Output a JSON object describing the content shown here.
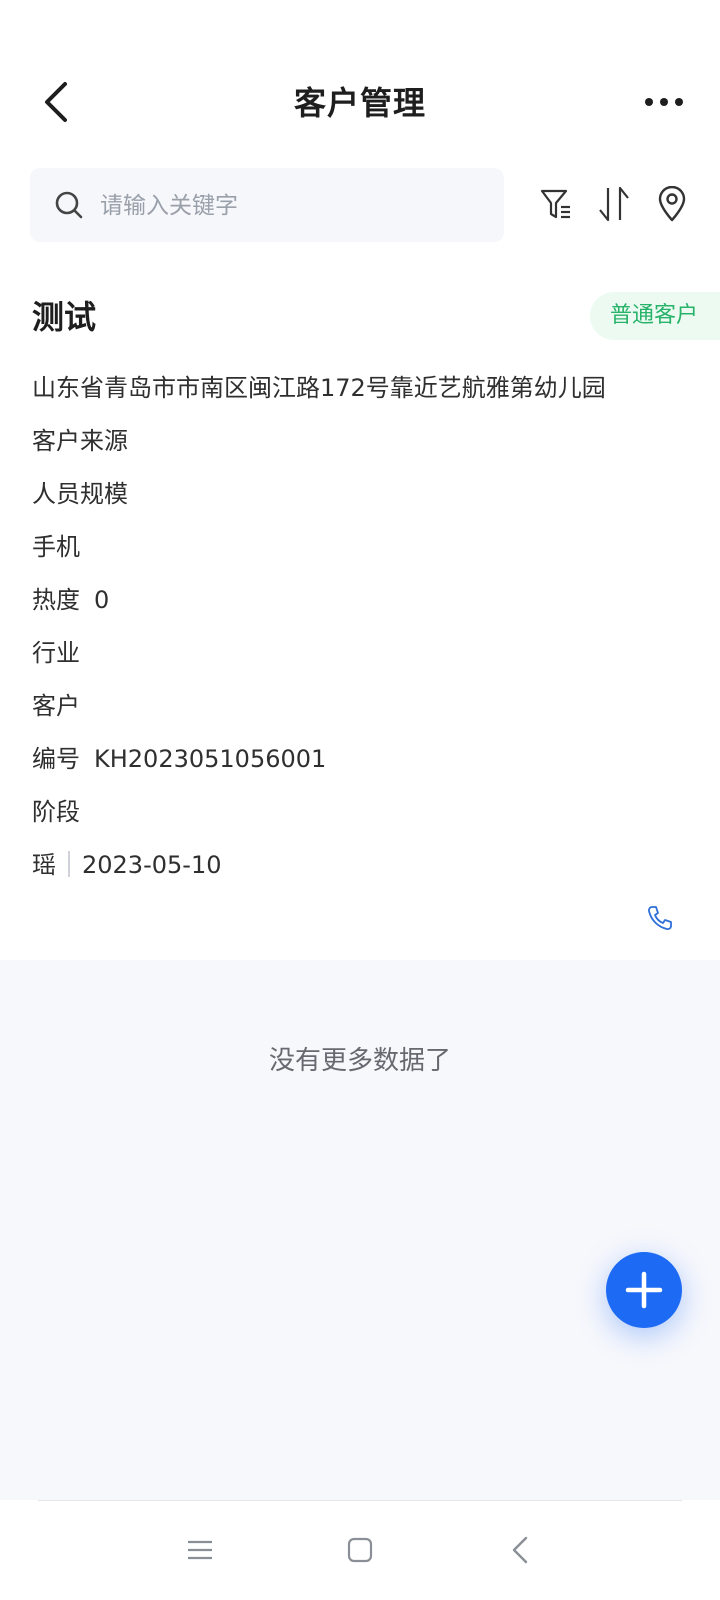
{
  "header": {
    "title": "客户管理"
  },
  "search": {
    "placeholder": "请输入关键字",
    "value": ""
  },
  "toolbar": {
    "icons": [
      "filter-icon",
      "sort-icon",
      "location-pin-icon"
    ]
  },
  "customer": {
    "name": "测试",
    "badge": "普通客户",
    "address": "山东省青岛市市南区闽江路172号靠近艺航雅第幼儿园",
    "fields": [
      {
        "label": "客户来源",
        "value": ""
      },
      {
        "label": "人员规模",
        "value": ""
      },
      {
        "label": "手机",
        "value": ""
      },
      {
        "label": "热度",
        "value": "0"
      },
      {
        "label": "行业",
        "value": ""
      },
      {
        "label": "客户",
        "value": ""
      },
      {
        "label": "编号",
        "value": "KH2023051056001"
      },
      {
        "label": "阶段",
        "value": ""
      }
    ],
    "owner": "瑶",
    "date": "2023-05-10"
  },
  "list": {
    "no_more": "没有更多数据了"
  },
  "colors": {
    "accent": "#1d6af5",
    "badge_text": "#27b36a",
    "badge_bg": "#ecfaf2",
    "background": "#f7f8fc"
  }
}
